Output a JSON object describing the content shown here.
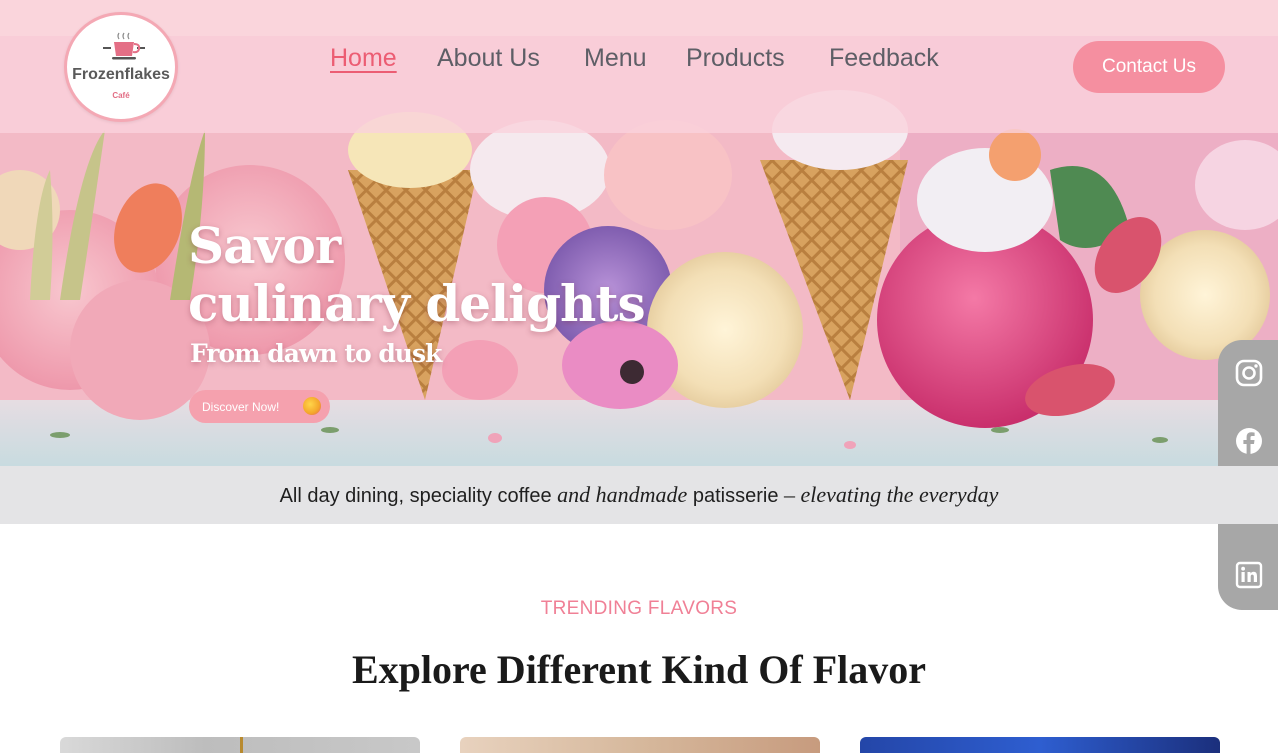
{
  "brand": {
    "name": "Frozenflakes",
    "sub": "Café",
    "accent": "#f58fa0"
  },
  "nav": {
    "items": [
      "Home",
      "About Us",
      "Menu",
      "Products",
      "Feedback"
    ],
    "active": "Home",
    "contact_label": "Contact Us"
  },
  "hero": {
    "line1": "Savor",
    "line2": "culinary delights",
    "subtitle": "From dawn to dusk",
    "cta_label": "Discover Now!"
  },
  "social": [
    "instagram-icon",
    "facebook-icon",
    "twitter-icon",
    "linkedin-icon"
  ],
  "tagline": {
    "part1": "All day dining, speciality coffee ",
    "part2": "and handmade",
    "part3": " patisserie ",
    "part4": "– elevating the everyday"
  },
  "trending": {
    "eyebrow": "TRENDING FLAVORS",
    "title": "Explore Different Kind Of Flavor"
  }
}
